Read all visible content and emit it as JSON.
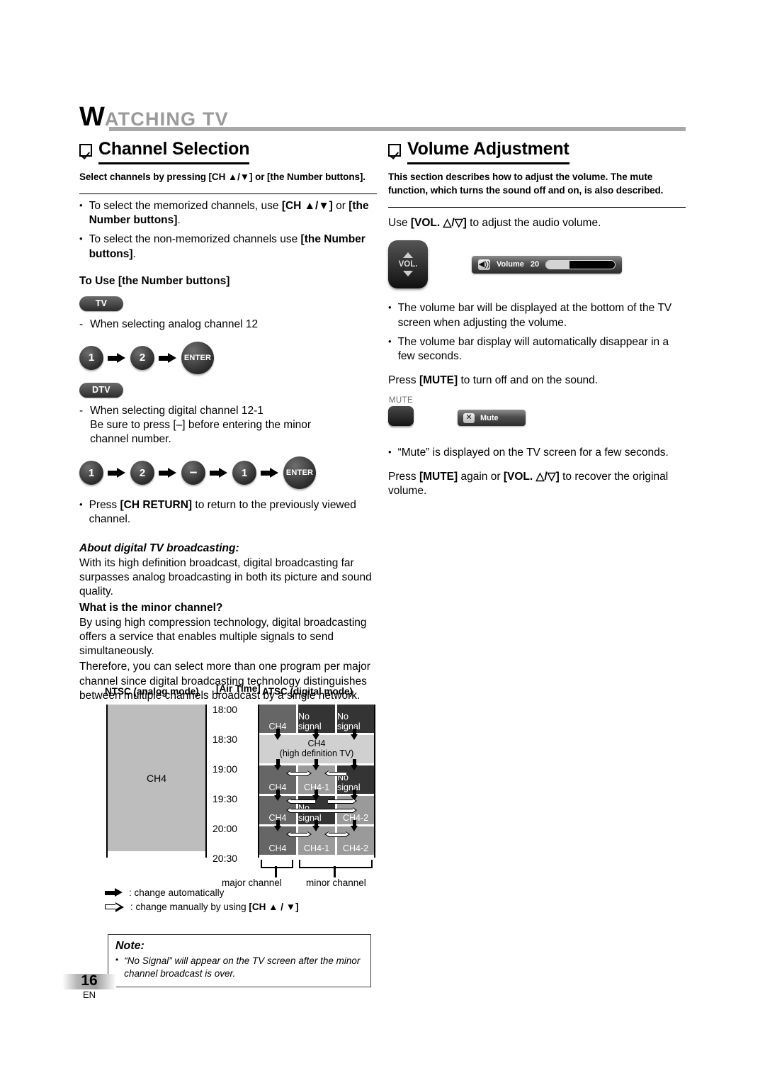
{
  "running_head": {
    "first_letter": "W",
    "rest": "ATCHING  TV"
  },
  "left": {
    "section_title": "Channel Selection",
    "lead": "Select channels by pressing [CH ▲/▼] or [the Number buttons].",
    "bullets": [
      {
        "pre": "To select the memorized channels, use ",
        "bold1": "[CH ▲/▼]",
        "mid": " or ",
        "bold2": "[the Number buttons]",
        "post": "."
      },
      {
        "pre": "To select the non-memorized channels use ",
        "bold1": "",
        "mid": "",
        "bold2": "[the Number buttons]",
        "post": "."
      }
    ],
    "number_buttons_head": "To Use [the Number buttons]",
    "tv_badge": "TV",
    "tv_line": "When selecting analog channel 12",
    "tv_sequence": [
      "1",
      "2",
      "ENTER"
    ],
    "dtv_badge": "DTV",
    "dtv_line1": "When selecting digital channel 12-1",
    "dtv_line2": "Be sure to press [–] before entering the minor",
    "dtv_line3": "channel number.",
    "dtv_sequence": [
      "1",
      "2",
      "–",
      "1",
      "ENTER"
    ],
    "ch_return_bullet_pre": "Press ",
    "ch_return_bullet_bold": "[CH RETURN]",
    "ch_return_bullet_post": " to return to the previously viewed channel.",
    "about_head": "About digital TV broadcasting:",
    "about_body": "With its high definition broadcast, digital broadcasting far surpasses analog broadcasting in both its picture and sound quality.",
    "minor_head": "What is the minor channel?",
    "minor_body1": "By using high compression technology, digital broadcasting offers a service that enables multiple signals to send simultaneously.",
    "minor_body2": "Therefore, you can select more than one program per major channel since digital broadcasting technology distinguishes between multiple channels broadcast by a single network."
  },
  "diagram": {
    "ntsc_header": "NTSC (analog mode)",
    "airtime_header": "[Air Time]",
    "atsc_header": "ATSC (digital mode)",
    "ntsc_label": "CH4",
    "times": [
      "18:00",
      "18:30",
      "19:00",
      "19:30",
      "20:00",
      "20:30"
    ],
    "rows": [
      {
        "type": "three",
        "cells": [
          {
            "label": "CH4",
            "shade": "g-med"
          },
          {
            "label": "No signal",
            "shade": "g-dark"
          },
          {
            "label": "No signal",
            "shade": "g-dark"
          }
        ]
      },
      {
        "type": "wide",
        "label_line1": "CH4",
        "label_line2": "(high definition TV)",
        "shade": "g-lgt"
      },
      {
        "type": "three",
        "cells": [
          {
            "label": "CH4",
            "shade": "g-med"
          },
          {
            "label": "CH4-1",
            "shade": "g-lmed"
          },
          {
            "label": "No signal",
            "shade": "g-dark"
          }
        ]
      },
      {
        "type": "three",
        "cells": [
          {
            "label": "CH4",
            "shade": "g-med"
          },
          {
            "label": "No signal",
            "shade": "g-dark"
          },
          {
            "label": "CH4-2",
            "shade": "g-lmed"
          }
        ]
      },
      {
        "type": "three",
        "cells": [
          {
            "label": "CH4",
            "shade": "g-med"
          },
          {
            "label": "CH4-1",
            "shade": "g-lmed"
          },
          {
            "label": "CH4-2",
            "shade": "g-lmed"
          }
        ]
      }
    ],
    "brace_major": "major channel",
    "brace_minor": "minor channel"
  },
  "legend": {
    "solid": ": change automatically",
    "open_pre": ": change manually by using ",
    "open_bold": "[CH ▲ / ▼]"
  },
  "note": {
    "title": "Note:",
    "body": "“No Signal” will appear on the TV screen after the minor channel broadcast is over."
  },
  "right": {
    "section_title": "Volume Adjustment",
    "lead": "This section describes how to adjust the volume. The mute function, which turns the sound off and on, is also described.",
    "use_vol_pre": "Use ",
    "use_vol_bold": "[VOL. △/▽]",
    "use_vol_post": " to adjust the audio volume.",
    "vol_button_label": "VOL.",
    "osd_volume_label": "Volume",
    "osd_volume_value": "20",
    "osd_volume_percent": 34,
    "bullets": [
      "The volume bar will be displayed at the bottom of the TV screen when adjusting the volume.",
      "The volume bar display will automatically disappear in a few seconds."
    ],
    "mute_press_pre": "Press ",
    "mute_press_bold": "[MUTE]",
    "mute_press_post": " to turn off and on the sound.",
    "mute_key_label": "MUTE",
    "osd_mute_label": "Mute",
    "mute_bullet": "“Mute” is displayed on the TV screen for a few seconds.",
    "recover_pre": "Press ",
    "recover_bold1": "[MUTE]",
    "recover_mid": " again or ",
    "recover_bold2": "[VOL. △/▽]",
    "recover_post": " to recover the original volume."
  },
  "footer": {
    "page_number": "16",
    "language": "EN"
  },
  "icons": {
    "speaker": "◀))",
    "mute": "✕"
  }
}
